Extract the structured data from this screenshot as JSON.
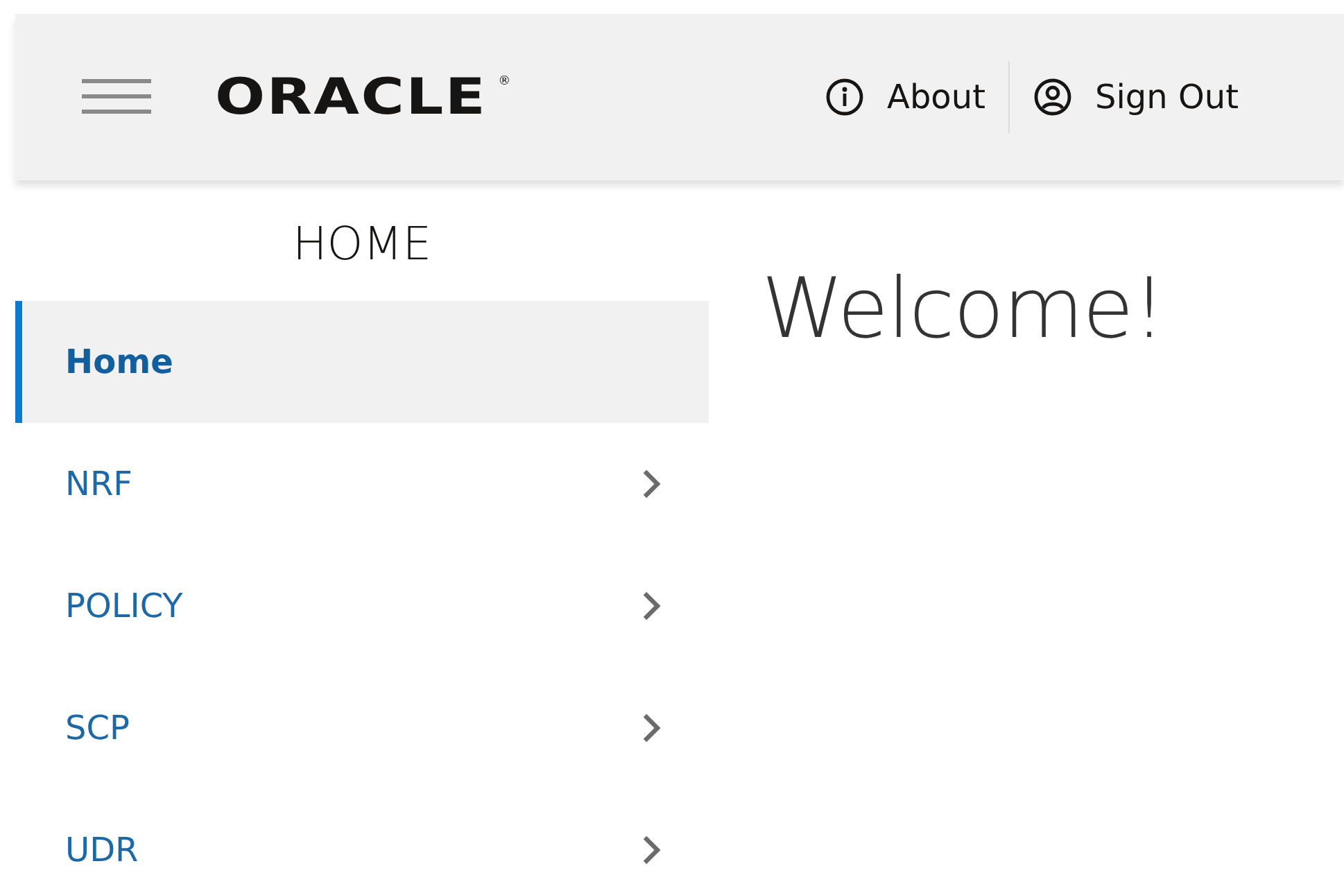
{
  "header": {
    "logo": "ORACLE",
    "logo_mark": "®",
    "actions": [
      {
        "kind": "about",
        "label": "About"
      },
      {
        "kind": "signout",
        "label": "Sign Out"
      }
    ]
  },
  "sidebar": {
    "title": "HOME",
    "items": [
      {
        "label": "Home",
        "selected": true,
        "expandable": false
      },
      {
        "label": "NRF",
        "selected": false,
        "expandable": true
      },
      {
        "label": "POLICY",
        "selected": false,
        "expandable": true
      },
      {
        "label": "SCP",
        "selected": false,
        "expandable": true
      },
      {
        "label": "UDR",
        "selected": false,
        "expandable": true
      }
    ]
  },
  "main": {
    "heading": "Welcome!"
  }
}
